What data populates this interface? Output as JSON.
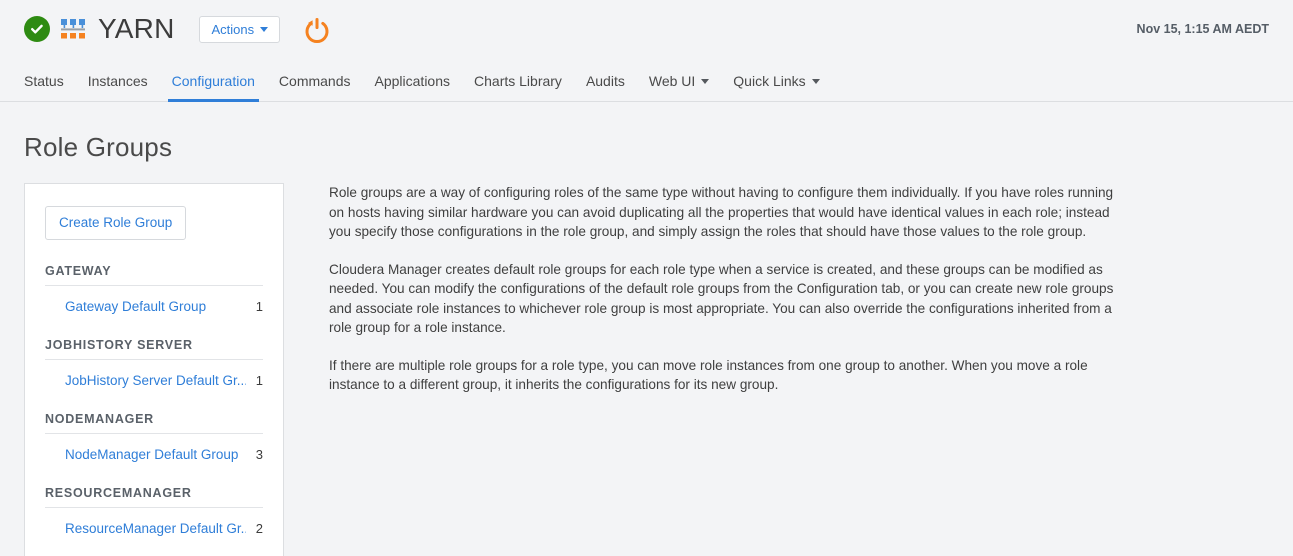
{
  "header": {
    "status_icon": "green-check-circle-icon",
    "service_icon": "yarn-service-icon",
    "service_title": "YARN",
    "actions_label": "Actions",
    "restart_icon": "restart-power-icon",
    "timestamp": "Nov 15, 1:15 AM AEDT",
    "colors": {
      "status_green": "#2e8b12",
      "accent_orange": "#f58220",
      "link_blue": "#2f7ed8",
      "icon_blue": "#4a90d9"
    }
  },
  "tabs": [
    {
      "label": "Status",
      "active": false,
      "dropdown": false
    },
    {
      "label": "Instances",
      "active": false,
      "dropdown": false
    },
    {
      "label": "Configuration",
      "active": true,
      "dropdown": false
    },
    {
      "label": "Commands",
      "active": false,
      "dropdown": false
    },
    {
      "label": "Applications",
      "active": false,
      "dropdown": false
    },
    {
      "label": "Charts Library",
      "active": false,
      "dropdown": false
    },
    {
      "label": "Audits",
      "active": false,
      "dropdown": false
    },
    {
      "label": "Web UI",
      "active": false,
      "dropdown": true
    },
    {
      "label": "Quick Links",
      "active": false,
      "dropdown": true
    }
  ],
  "page": {
    "title": "Role Groups"
  },
  "sidebar": {
    "create_button_label": "Create Role Group",
    "sections": [
      {
        "header": "GATEWAY",
        "items": [
          {
            "label": "Gateway Default Group",
            "count": "1"
          }
        ]
      },
      {
        "header": "JOBHISTORY SERVER",
        "items": [
          {
            "label": "JobHistory Server Default Gr...",
            "count": "1"
          }
        ]
      },
      {
        "header": "NODEMANAGER",
        "items": [
          {
            "label": "NodeManager Default Group",
            "count": "3"
          }
        ]
      },
      {
        "header": "RESOURCEMANAGER",
        "items": [
          {
            "label": "ResourceManager Default Gr...",
            "count": "2"
          }
        ]
      }
    ]
  },
  "main": {
    "paragraphs": [
      "Role groups are a way of configuring roles of the same type without having to configure them individually. If you have roles running on hosts having similar hardware you can avoid duplicating all the properties that would have identical values in each role; instead you specify those configurations in the role group, and simply assign the roles that should have those values to the role group.",
      "Cloudera Manager creates default role groups for each role type when a service is created, and these groups can be modified as needed. You can modify the configurations of the default role groups from the Configuration tab, or you can create new role groups and associate role instances to whichever role group is most appropriate. You can also override the configurations inherited from a role group for a role instance.",
      "If there are multiple role groups for a role type, you can move role instances from one group to another. When you move a role instance to a different group, it inherits the configurations for its new group."
    ]
  }
}
